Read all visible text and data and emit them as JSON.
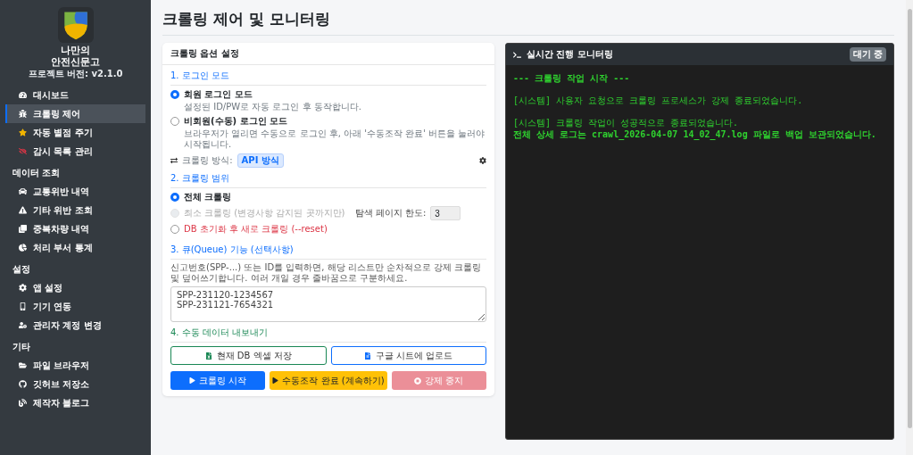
{
  "sidebar": {
    "app_name": [
      "나만의",
      "안전신문고"
    ],
    "version": "프로젝트 버전: v2.1.0",
    "sections": [
      {
        "items": [
          {
            "label": "대시보드",
            "selected": false
          },
          {
            "label": "크롤링 제어",
            "selected": true
          },
          {
            "label": "자동 별점 주기",
            "selected": false
          },
          {
            "label": "감시 목록 관리",
            "selected": false
          }
        ]
      },
      {
        "heading": "데이터 조회",
        "items": [
          {
            "label": "교통위반 내역",
            "selected": false
          },
          {
            "label": "기타 위반 조회",
            "selected": false
          },
          {
            "label": "중복차량 내역",
            "selected": false
          },
          {
            "label": "처리 부서 통계",
            "selected": false
          }
        ]
      },
      {
        "heading": "설정",
        "items": [
          {
            "label": "앱 설정",
            "selected": false
          },
          {
            "label": "기기 연동",
            "selected": false
          },
          {
            "label": "관리자 계정 변경",
            "selected": false
          }
        ]
      },
      {
        "heading": "기타",
        "items": [
          {
            "label": "파일 브라우저",
            "selected": false
          },
          {
            "label": "깃허브 저장소",
            "selected": false
          },
          {
            "label": "제작자 블로그",
            "selected": false
          }
        ]
      }
    ]
  },
  "page_title": "크롤링 제어 및 모니터링",
  "options_card": {
    "title": "크롤링 옵션 설정",
    "login": {
      "heading": "1. 로그인 모드",
      "options": [
        {
          "label": "회원 로그인 모드",
          "description": "설정된 ID/PW로 자동 로그인 후 동작합니다.",
          "checked": true
        },
        {
          "label": "비회원(수동) 로그인 모드",
          "description": "브라우저가 열리면 수동으로 로그인 후, 아래 '수동조작 완료' 버튼을 눌러야 시작됩니다.",
          "checked": false
        }
      ],
      "method_label": "크롤링 방식:",
      "method_badge": "API 방식"
    },
    "scope": {
      "heading": "2. 크롤링 범위",
      "options": [
        {
          "label": "전체 크롤링",
          "checked": true,
          "disabled": false,
          "kind": "normal"
        },
        {
          "label": "최소 크롤링 (변경사항 감지된 곳까지만)",
          "checked": false,
          "disabled": true,
          "kind": "normal",
          "limit_label": "탐색 페이지 한도:",
          "limit_value": "3"
        },
        {
          "label": "DB 초기화 후 새로 크롤링 (--reset)",
          "checked": false,
          "disabled": false,
          "kind": "danger"
        }
      ]
    },
    "queue": {
      "heading": "3. 큐(Queue) 기능 (선택사항)",
      "help": "신고번호(SPP-...) 또는 ID를 입력하면, 해당 리스트만 순차적으로 강제 크롤링 및 덮어쓰기합니다. 여러 개일 경우 줄바꿈으로 구분하세요.",
      "value": "SPP-231120-1234567\nSPP-231121-7654321"
    },
    "export": {
      "heading": "4. 수동 데이터 내보내기",
      "buttons": [
        {
          "label": "현재 DB 엑셀 저장",
          "kind": "excel"
        },
        {
          "label": "구글 시트에 업로드",
          "kind": "sheets"
        }
      ]
    },
    "actions": [
      {
        "label": "크롤링 시작",
        "kind": "primary",
        "disabled": false
      },
      {
        "label": "수동조작 완료 (계속하기)",
        "kind": "warning",
        "disabled": false
      },
      {
        "label": "강제 중지",
        "kind": "danger",
        "disabled": true
      }
    ]
  },
  "monitor": {
    "title": "실시간 진행 모니터링",
    "status": "대기 중",
    "blocks": [
      [
        {
          "text": "--- 크롤링 작업 시작 ---",
          "bold": true
        }
      ],
      [
        {
          "text": "[시스템] 사용자 요청으로 크롤링 프로세스가 강제 종료되었습니다.",
          "bold": false
        }
      ],
      [
        {
          "text": "[시스템] 크롤링 작업이 성공적으로 종료되었습니다.",
          "bold": false
        },
        {
          "text": "전체 상세 로그는 crawl_2026-04-07 14_02_47.log 파일로 백업 보관되었습니다.",
          "bold": true
        }
      ]
    ]
  }
}
